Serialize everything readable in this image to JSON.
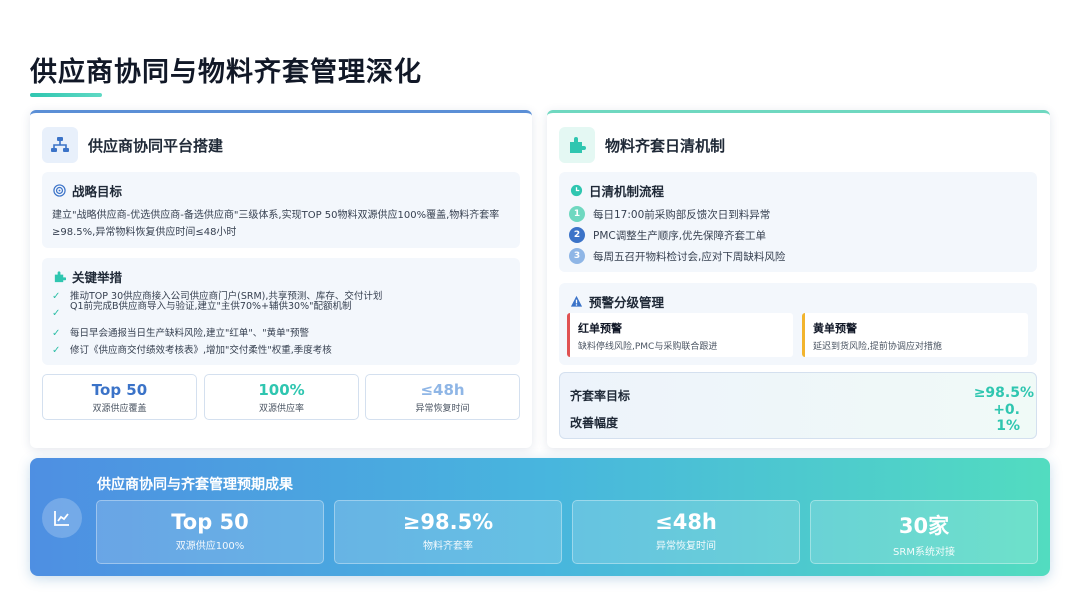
{
  "page": {
    "title": "供应商协同与物料齐套管理深化"
  },
  "left_card": {
    "title": "供应商协同平台搭建",
    "goal": {
      "title": "战略目标",
      "text": "建立\"战略供应商-优选供应商-备选供应商\"三级体系,实现TOP 50物料双源供应100%覆盖,物料齐套率≥98.5%,异常物料恢复供应时间≤48小时"
    },
    "measures": {
      "title": "关键举措",
      "items": [
        "推动TOP 30供应商接入公司供应商门户(SRM),共享预测、库存、交付计划",
        "Q1前完成B供应商导入与验证,建立\"主供70%+辅供30%\"配额机制",
        "每日早会通报当日生产缺料风险,建立\"红单\"、\"黄单\"预警",
        "修订《供应商交付绩效考核表》,增加\"交付柔性\"权重,季度考核"
      ]
    },
    "stats": [
      {
        "value": "Top 50",
        "label": "双源供应覆盖",
        "color": "#3b73c8"
      },
      {
        "value": "100%",
        "label": "双源供应率",
        "color": "#2fc6b0"
      },
      {
        "value": "≤48h",
        "label": "异常恢复时间",
        "color": "#8fb6e6"
      }
    ]
  },
  "right_card": {
    "title": "物料齐套日清机制",
    "flow": {
      "title": "日清机制流程",
      "steps": [
        {
          "num": "1",
          "text": "每日17:00前采购部反馈次日到料异常",
          "color": "#6fd8c0"
        },
        {
          "num": "2",
          "text": "PMC调整生产顺序,优先保障齐套工单",
          "color": "#3b73c8"
        },
        {
          "num": "3",
          "text": "每周五召开物料检讨会,应对下周缺料风险",
          "color": "#8fb6e6"
        }
      ]
    },
    "alerts": {
      "title": "预警分级管理",
      "red": {
        "title": "红单预警",
        "desc": "缺料停线风险,PMC与采购联合跟进",
        "color": "#e05252"
      },
      "yellow": {
        "title": "黄单预警",
        "desc": "延迟到货风险,提前协调应对措施",
        "color": "#f2b42d"
      }
    },
    "rate": {
      "target_label": "齐套率目标",
      "target_value": "≥98.5%",
      "improve_label": "改善幅度",
      "improve_value": "+0.1%"
    }
  },
  "banner": {
    "title": "供应商协同与齐套管理预期成果",
    "stats": [
      {
        "value": "Top 50",
        "label": "双源供应100%"
      },
      {
        "value": "≥98.5%",
        "label": "物料齐套率"
      },
      {
        "value": "≤48h",
        "label": "异常恢复时间"
      },
      {
        "value": "30家",
        "label": "SRM系统对接"
      }
    ]
  }
}
